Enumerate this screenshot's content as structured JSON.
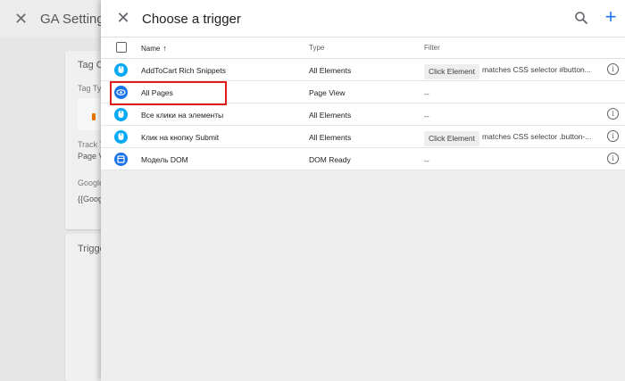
{
  "background": {
    "title": "GA Settings",
    "card1": {
      "title": "Tag C",
      "tag_type_label": "Tag Typ",
      "track_type_label": "Track T",
      "track_type_value": "Page V",
      "google_label": "Google",
      "google_value": "{{Goog"
    },
    "card2": {
      "title": "Trigge"
    }
  },
  "panel": {
    "title": "Choose a trigger",
    "columns": {
      "name": "Name",
      "type": "Type",
      "filter": "Filter"
    },
    "rows": [
      {
        "name": "AddToCart Rich Snippets",
        "type": "All Elements",
        "chip": "Click Element",
        "filter_text": "matches CSS selector #button...",
        "icon": "click-icon",
        "color": "#03a9f4",
        "info": true
      },
      {
        "name": "All Pages",
        "type": "Page View",
        "chip": "",
        "filter_text": "--",
        "icon": "eye-icon",
        "color": "#1a73e8",
        "info": false
      },
      {
        "name": "Все клики на элементы",
        "type": "All Elements",
        "chip": "",
        "filter_text": "--",
        "icon": "click-icon",
        "color": "#03a9f4",
        "info": true
      },
      {
        "name": "Клик на кнопку Submit",
        "type": "All Elements",
        "chip": "Click Element",
        "filter_text": "matches CSS selector .button-...",
        "icon": "click-icon",
        "color": "#03a9f4",
        "info": true
      },
      {
        "name": "Модель DOM",
        "type": "DOM Ready",
        "chip": "",
        "filter_text": "--",
        "icon": "dom-icon",
        "color": "#1a73e8",
        "info": true
      }
    ]
  },
  "colors": {
    "accent": "#1a73e8",
    "highlight": "#e01b1b"
  }
}
